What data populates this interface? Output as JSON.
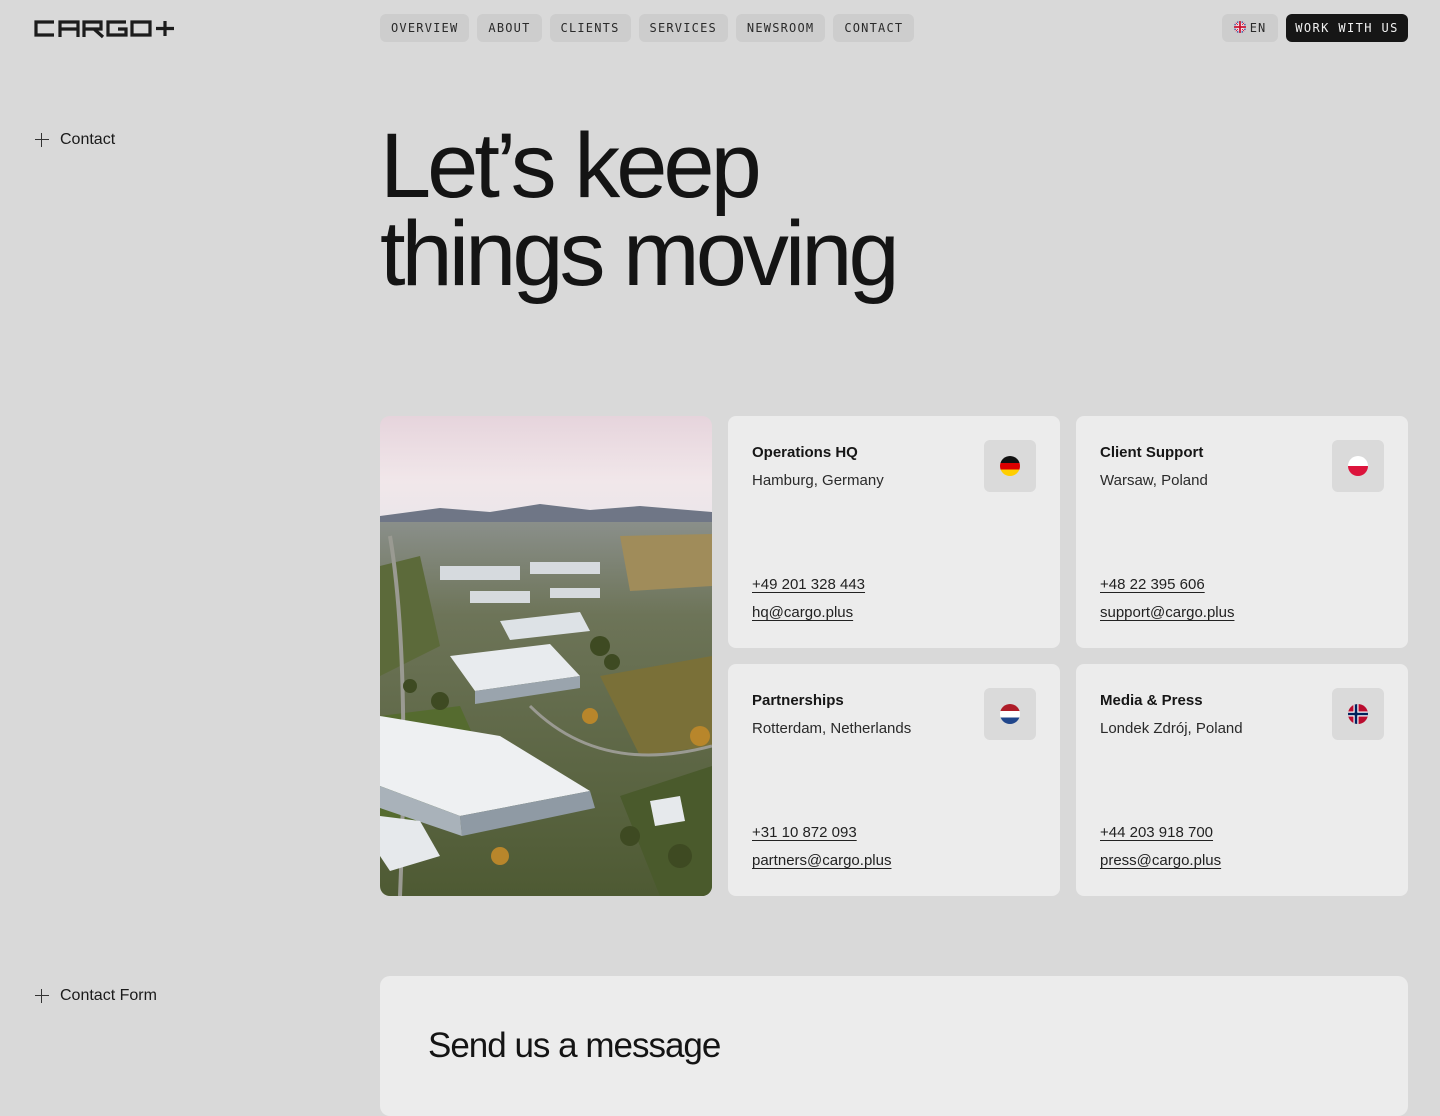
{
  "header": {
    "logo_text": "CARGO+",
    "nav": [
      "OVERVIEW",
      "ABOUT",
      "CLIENTS",
      "SERVICES",
      "NEWSROOM",
      "CONTACT"
    ],
    "language": "EN",
    "cta": "WORK WITH US"
  },
  "sections": {
    "contact_label": "Contact",
    "form_label": "Contact Form"
  },
  "hero": {
    "line1": "Let’s keep",
    "line2": "things moving"
  },
  "offices": [
    {
      "title": "Operations HQ",
      "city": "Hamburg, Germany",
      "phone": "+49 201 328 443",
      "email": "hq@cargo.plus",
      "flag": "germany-flag-icon"
    },
    {
      "title": "Client Support",
      "city": "Warsaw, Poland",
      "phone": "+48 22 395 606",
      "email": "support@cargo.plus",
      "flag": "poland-flag-icon"
    },
    {
      "title": "Partnerships",
      "city": "Rotterdam, Netherlands",
      "phone": "+31 10 872 093",
      "email": "partners@cargo.plus",
      "flag": "netherlands-flag-icon"
    },
    {
      "title": "Media & Press",
      "city": "Londek Zdrój, Poland",
      "phone": "+44 203 918 700",
      "email": "press@cargo.plus",
      "flag": "norway-flag-icon"
    }
  ],
  "form": {
    "title": "Send us a message"
  },
  "colors": {
    "background": "#d9d9d9",
    "card": "#ececec",
    "nav_pill": "#cdcdcd",
    "cta_bg": "#161616",
    "text": "#141414"
  }
}
